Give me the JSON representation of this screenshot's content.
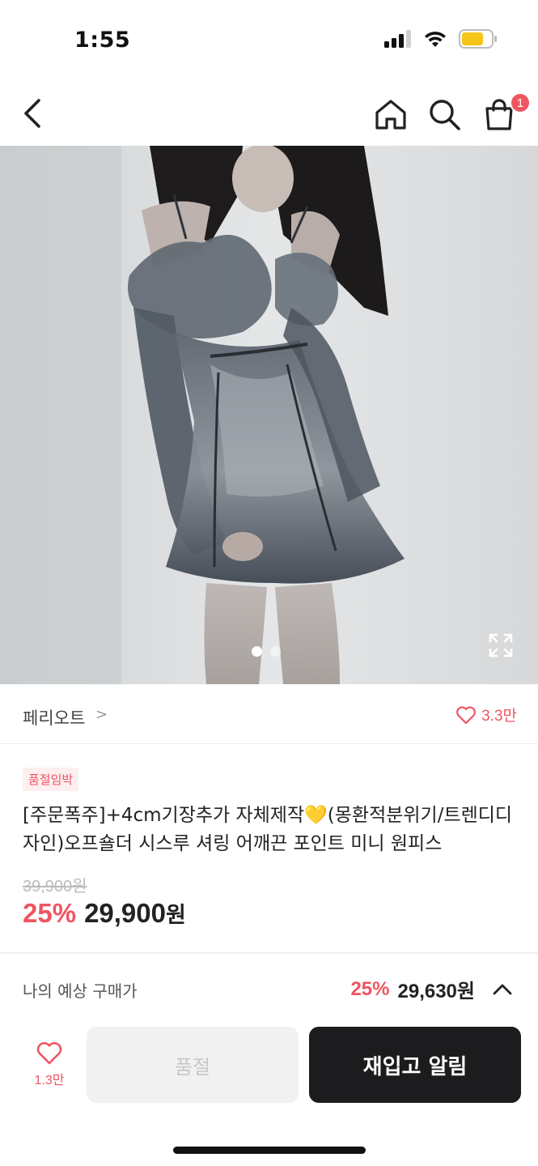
{
  "status_bar": {
    "time": "1:55"
  },
  "nav": {
    "cart_count": "1"
  },
  "gallery": {
    "current_index": 1,
    "total": 2
  },
  "brand": {
    "name": "페리오트",
    "chevron": ">",
    "like_count": "3.3만"
  },
  "product": {
    "tag": "품절임박",
    "title": "[주문폭주]+4cm기장추가 자체제작💛(몽환적분위기/트렌디디자인)오프숄더 시스루 셔링 어깨끈 포인트 미니 원피스",
    "original_price": "39,900원",
    "discount": "25%",
    "sale_price_number": "29,900",
    "sale_price_unit": "원"
  },
  "estimate": {
    "label": "나의 예상 구매가",
    "discount": "25%",
    "price": "29,630원"
  },
  "bottom": {
    "wish_count": "1.3만",
    "soldout_label": "품절",
    "restock_label": "재입고 알림"
  },
  "colors": {
    "accent": "#ef5561",
    "dark_button": "#1c1c1e",
    "disabled_button": "#f1f1f1"
  }
}
